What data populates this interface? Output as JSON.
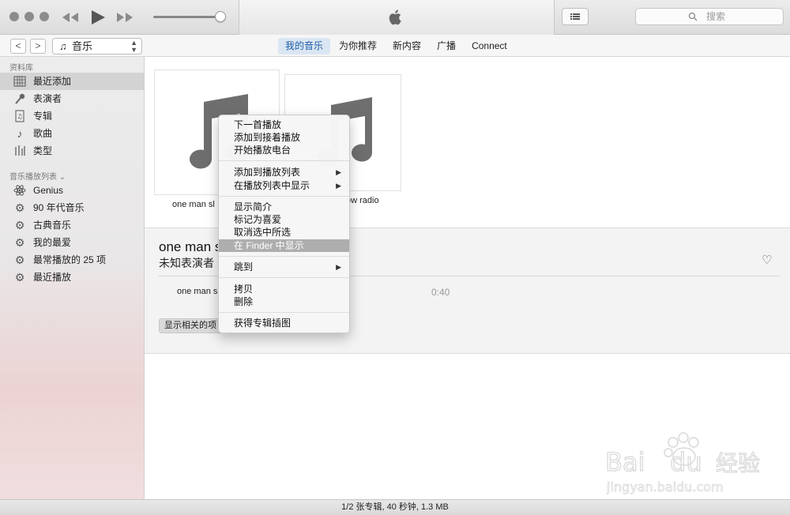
{
  "colors": {
    "accent": "#1f5ea8",
    "tab_active_bg": "#dbe6f3",
    "menu_highlight": "#aeaeae"
  },
  "titlebar": {
    "icons": [
      "rewind-icon",
      "play-icon",
      "fast-forward-icon",
      "apple-icon",
      "list-icon",
      "search-icon"
    ],
    "search_placeholder": "搜索"
  },
  "navbar": {
    "back": "<",
    "forward": ">",
    "source": "音乐",
    "tabs": [
      {
        "label": "我的音乐",
        "active": true
      },
      {
        "label": "为你推荐",
        "active": false
      },
      {
        "label": "新内容",
        "active": false
      },
      {
        "label": "广播",
        "active": false
      },
      {
        "label": "Connect",
        "active": false
      }
    ]
  },
  "sidebar": {
    "library_header": "资料库",
    "library": [
      {
        "label": "最近添加",
        "icon": "grid-icon",
        "selected": true
      },
      {
        "label": "表演者",
        "icon": "microphone-icon",
        "selected": false
      },
      {
        "label": "专辑",
        "icon": "album-icon",
        "selected": false
      },
      {
        "label": "歌曲",
        "icon": "note-icon",
        "selected": false
      },
      {
        "label": "类型",
        "icon": "genre-icon",
        "selected": false
      }
    ],
    "playlists_header": "音乐播放列表",
    "playlists": [
      {
        "label": "Genius",
        "icon": "atom-icon"
      },
      {
        "label": "90 年代音乐",
        "icon": "gear-icon"
      },
      {
        "label": "古典音乐",
        "icon": "gear-icon"
      },
      {
        "label": "我的最爱",
        "icon": "gear-icon"
      },
      {
        "label": "最常播放的 25 项",
        "icon": "gear-icon"
      },
      {
        "label": "最近播放",
        "icon": "gear-icon"
      }
    ]
  },
  "albums": [
    {
      "title": "one man sl"
    },
    {
      "title": "ow radio"
    }
  ],
  "detail": {
    "title": "one man s",
    "artist": "未知表演者",
    "track": "one man s",
    "time": "0:40",
    "related_button": "显示相关的项"
  },
  "context_menu": {
    "items": [
      {
        "label": "下一首播放"
      },
      {
        "label": "添加到接着播放"
      },
      {
        "label": "开始播放电台"
      },
      {
        "label": "添加到播放列表",
        "submenu": true
      },
      {
        "label": "在播放列表中显示",
        "submenu": true
      },
      {
        "label": "显示简介"
      },
      {
        "label": "标记为喜爱"
      },
      {
        "label": "取消选中所选"
      },
      {
        "label": "在 Finder 中显示",
        "highlighted": true
      },
      {
        "label": "跳到",
        "submenu": true
      },
      {
        "label": "拷贝"
      },
      {
        "label": "删除"
      },
      {
        "label": "获得专辑插图"
      }
    ],
    "submenu_arrow": "▶"
  },
  "statusbar": {
    "text": "1/2 张专辑, 40 秒钟, 1.3 MB"
  },
  "watermark": {
    "brand": "Bai",
    "brand2": "du",
    "cn": "经验",
    "url": "jingyan.baidu.com"
  }
}
